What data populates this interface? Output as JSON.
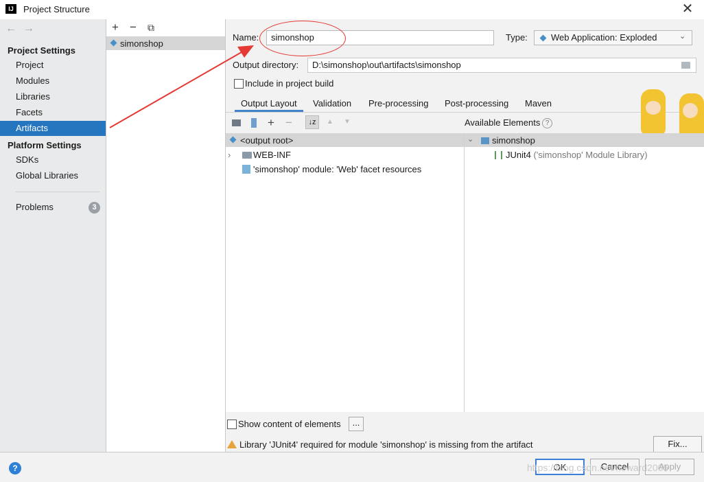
{
  "window": {
    "title": "Project Structure",
    "app_icon_text": "IJ"
  },
  "sidebar": {
    "back_arrow": "←",
    "forward_arrow": "→",
    "project_settings_heading": "Project Settings",
    "project_settings_items": [
      {
        "label": "Project"
      },
      {
        "label": "Modules"
      },
      {
        "label": "Libraries"
      },
      {
        "label": "Facets"
      },
      {
        "label": "Artifacts"
      }
    ],
    "platform_settings_heading": "Platform Settings",
    "platform_settings_items": [
      {
        "label": "SDKs"
      },
      {
        "label": "Global Libraries"
      }
    ],
    "problems_label": "Problems",
    "problems_count": "3"
  },
  "artifacts": {
    "toolbar": {
      "add": "+",
      "remove": "−",
      "copy": "⧉"
    },
    "items": [
      {
        "label": "simonshop"
      }
    ]
  },
  "main": {
    "name_label": "Name:",
    "name_value": "simonshop",
    "type_label": "Type:",
    "type_value": "Web Application: Exploded",
    "output_dir_label": "Output directory:",
    "output_dir_value": "D:\\simonshop\\out\\artifacts\\simonshop",
    "include_build_label": "Include in project build",
    "tabs": [
      {
        "label": "Output Layout"
      },
      {
        "label": "Validation"
      },
      {
        "label": "Pre-processing"
      },
      {
        "label": "Post-processing"
      },
      {
        "label": "Maven"
      }
    ],
    "available_elements_label": "Available Elements",
    "layout_tree": [
      {
        "label": "<output root>"
      },
      {
        "label": "WEB-INF"
      },
      {
        "label": "'simonshop' module: 'Web' facet resources"
      }
    ],
    "available_tree": {
      "root": "simonshop",
      "child_name": "JUnit4",
      "child_detail": " ('simonshop' Module Library)"
    },
    "show_content_label": "Show content of elements",
    "show_content_button": "...",
    "warning_text": "Library 'JUnit4' required for module 'simonshop' is missing from the artifact",
    "fix_button": "Fix..."
  },
  "footer": {
    "help": "?",
    "ok": "OK",
    "cancel": "Cancel",
    "apply": "Apply",
    "watermark": "https://blog.csdn.net/howard2005"
  },
  "colors": {
    "selection": "#2675bf",
    "annotation_red": "#e53935",
    "warning": "#e8a33d"
  }
}
